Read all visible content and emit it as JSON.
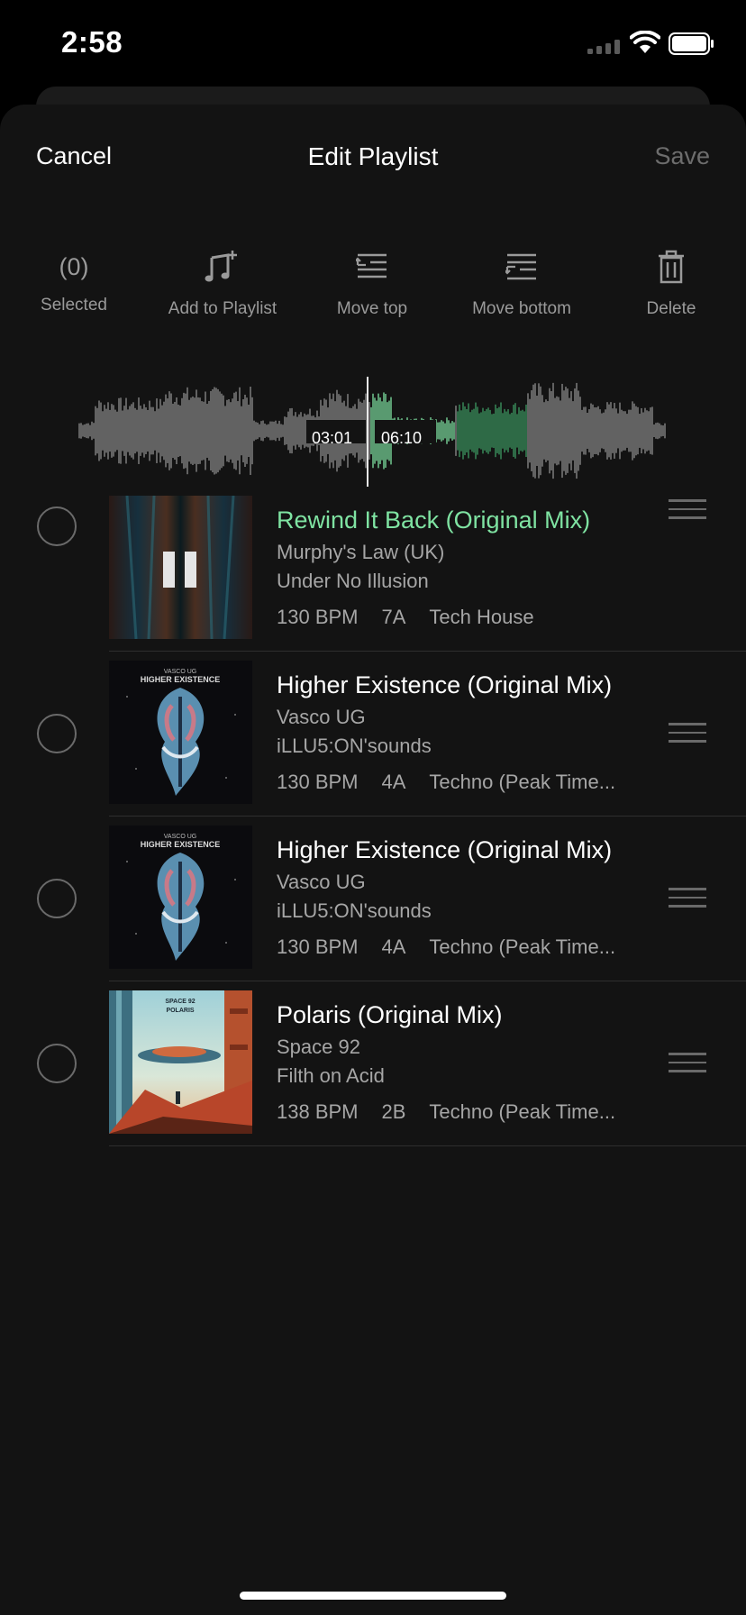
{
  "status_bar": {
    "time": "2:58",
    "signal": "signal-icon",
    "wifi": "wifi-icon",
    "battery": "battery-icon"
  },
  "nav": {
    "cancel_label": "Cancel",
    "title": "Edit Playlist",
    "save_label": "Save"
  },
  "toolbar": {
    "selected_count": "(0)",
    "selected_label": "Selected",
    "add_label": "Add to Playlist",
    "move_top_label": "Move top",
    "move_bottom_label": "Move bottom",
    "delete_label": "Delete"
  },
  "player": {
    "elapsed": "03:01",
    "duration": "06:10",
    "accent_color": "#7fe3a2"
  },
  "tracks": [
    {
      "title": "Rewind It Back (Original Mix)",
      "artist": "Murphy's Law (UK)",
      "label": "Under No Illusion",
      "bpm": "130 BPM",
      "key": "7A",
      "genre": "Tech House",
      "playing": true
    },
    {
      "title": "Higher Existence (Original Mix)",
      "artist": "Vasco UG",
      "label": "iLLU5:ON'sounds",
      "bpm": "130 BPM",
      "key": "4A",
      "genre": "Techno (Peak Time...",
      "playing": false,
      "cover_text": [
        "VASCO UG",
        "HIGHER EXISTENCE"
      ]
    },
    {
      "title": "Higher Existence (Original Mix)",
      "artist": "Vasco UG",
      "label": "iLLU5:ON'sounds",
      "bpm": "130 BPM",
      "key": "4A",
      "genre": "Techno (Peak Time...",
      "playing": false,
      "cover_text": [
        "VASCO UG",
        "HIGHER EXISTENCE"
      ]
    },
    {
      "title": "Polaris (Original Mix)",
      "artist": "Space 92",
      "label": "Filth on Acid",
      "bpm": "138 BPM",
      "key": "2B",
      "genre": "Techno (Peak Time...",
      "playing": false,
      "cover_text": [
        "SPACE 92",
        "POLARIS"
      ]
    }
  ]
}
